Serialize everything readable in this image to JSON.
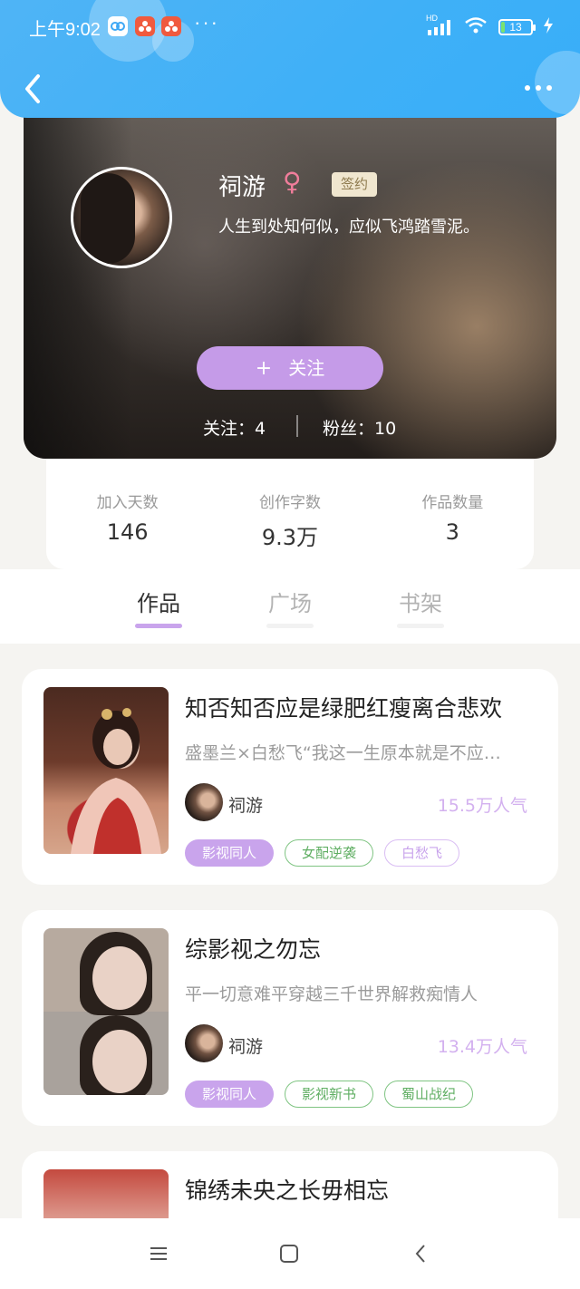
{
  "status_bar": {
    "time": "上午9:02",
    "more": "···",
    "network": "HD",
    "battery": "13"
  },
  "profile": {
    "name": "祠游",
    "gender_symbol": "♀",
    "signed_tag": "签约",
    "bio": "人生到处知何似，应似飞鸿踏雪泥。",
    "follow_label": "关注",
    "follow_plus": "+",
    "following_text": "关注：4",
    "fans_text": "粉丝：10"
  },
  "stats": [
    {
      "label": "加入天数",
      "value": "146"
    },
    {
      "label": "创作字数",
      "value": "9.3万"
    },
    {
      "label": "作品数量",
      "value": "3"
    }
  ],
  "tabs": [
    {
      "label": "作品",
      "active": true
    },
    {
      "label": "广场",
      "active": false
    },
    {
      "label": "书架",
      "active": false
    }
  ],
  "books": [
    {
      "title": "知否知否应是绿肥红瘦离合悲欢",
      "desc": "盛墨兰×白愁飞“我这一生原本就是不应…",
      "author": "祠游",
      "popularity": "15.5万人气",
      "tags": [
        "影视同人",
        "女配逆袭",
        "白愁飞"
      ]
    },
    {
      "title": "综影视之勿忘",
      "desc": "平一切意难平穿越三千世界解救痴情人",
      "author": "祠游",
      "popularity": "13.4万人气",
      "tags": [
        "影视同人",
        "影视新书",
        "蜀山战纪"
      ]
    },
    {
      "title": "锦绣未央之长毋相忘",
      "desc": "",
      "author": "",
      "popularity": "",
      "tags": []
    }
  ],
  "colors": {
    "header": "#3fb0f7",
    "accent_purple": "#c9a4ec",
    "tag_green": "#5fae62",
    "signed_tag_bg": "#f0e6cf"
  }
}
